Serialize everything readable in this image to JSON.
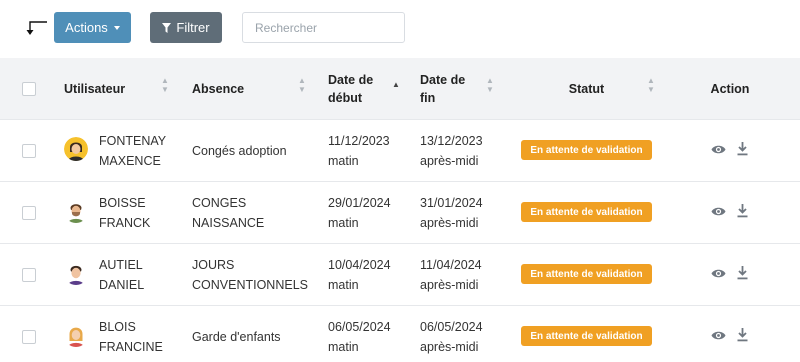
{
  "toolbar": {
    "back_icon": "corner-arrow-icon",
    "actions_label": "Actions",
    "filter_label": "Filtrer",
    "filter_icon": "funnel-icon",
    "search_placeholder": "Rechercher"
  },
  "colors": {
    "actions_button": "#4f8fb8",
    "filter_button": "#5f6d78",
    "status_badge": "#f0a023",
    "header_bg": "#f2f3f5"
  },
  "table": {
    "columns": {
      "user": "Utilisateur",
      "absence": "Absence",
      "start_line1": "Date de",
      "start_line2": "début",
      "end_line1": "Date de",
      "end_line2": "fin",
      "status": "Statut",
      "action": "Action"
    },
    "sorted_column": "Date de début",
    "rows": [
      {
        "last": "FONTENAY",
        "first": "MAXENCE",
        "absence1": "Congés adoption",
        "absence2": "",
        "start_date": "11/12/2023",
        "start_half": "matin",
        "end_date": "13/12/2023",
        "end_half": "après-midi",
        "status": "En attente de validation",
        "avatar": "avatar-icon"
      },
      {
        "last": "BOISSE",
        "first": "FRANCK",
        "absence1": "CONGES",
        "absence2": "NAISSANCE",
        "start_date": "29/01/2024",
        "start_half": "matin",
        "end_date": "31/01/2024",
        "end_half": "après-midi",
        "status": "En attente de validation",
        "avatar": "avatar-icon"
      },
      {
        "last": "AUTIEL",
        "first": "DANIEL",
        "absence1": "JOURS",
        "absence2": "CONVENTIONNELS",
        "start_date": "10/04/2024",
        "start_half": "matin",
        "end_date": "11/04/2024",
        "end_half": "après-midi",
        "status": "En attente de validation",
        "avatar": "avatar-icon"
      },
      {
        "last": "BLOIS",
        "first": "FRANCINE",
        "absence1": "Garde d'enfants",
        "absence2": "",
        "start_date": "06/05/2024",
        "start_half": "matin",
        "end_date": "06/05/2024",
        "end_half": "après-midi",
        "status": "En attente de validation",
        "avatar": "avatar-icon"
      }
    ],
    "row_action_icons": [
      "eye-icon",
      "download-icon"
    ]
  }
}
